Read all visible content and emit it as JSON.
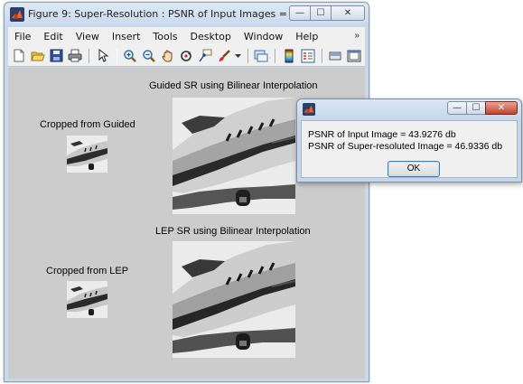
{
  "window": {
    "title": "Figure 9: Super-Resolution : PSNR of Input Images = 43....",
    "buttons": {
      "minimize": "—",
      "maximize": "☐",
      "close": "✕"
    }
  },
  "menu": {
    "items": [
      "File",
      "Edit",
      "View",
      "Insert",
      "Tools",
      "Desktop",
      "Window",
      "Help"
    ],
    "overflow": "»"
  },
  "toolbar": {
    "icons": [
      "new-figure-icon",
      "open-file-icon",
      "save-icon",
      "print-icon",
      "pointer-icon",
      "zoom-in-icon",
      "zoom-out-icon",
      "pan-icon",
      "rotate-3d-icon",
      "data-cursor-icon",
      "brush-icon",
      "link-plot-icon",
      "colorbar-icon",
      "legend-icon",
      "hide-plot-tools-icon",
      "show-plot-tools-icon"
    ]
  },
  "figure": {
    "titles": {
      "guided_sr": "Guided SR using Bilinear Interpolation",
      "cropped_guided": "Cropped from Guided",
      "lep_sr": "LEP SR using Bilinear Interpolation",
      "cropped_lep": "Cropped from LEP"
    }
  },
  "dialog": {
    "line1": "PSNR of Input Image = 43.9276 db",
    "line2": "PSNR of Super-resoluted Image = 46.9336 db",
    "ok_label": "OK",
    "buttons": {
      "minimize": "—",
      "maximize": "☐",
      "close": "✕"
    }
  },
  "colors": {
    "canvas_bg": "#cccccc",
    "titlebar": "#c9d9ec",
    "close_button": "#c4432b"
  }
}
